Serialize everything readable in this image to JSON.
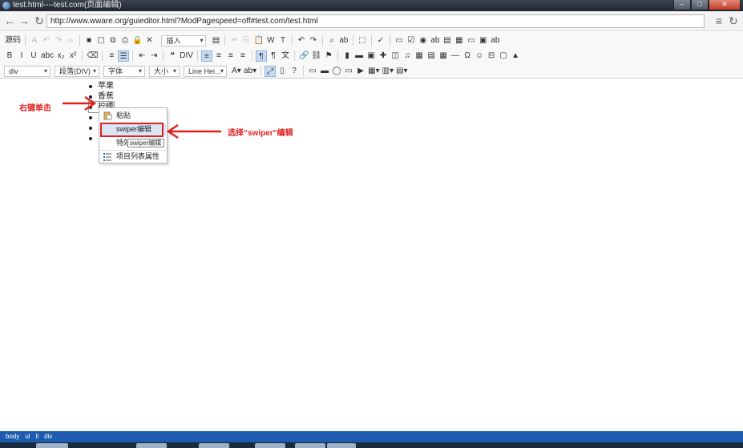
{
  "window": {
    "title": "test.html----test.com(页面编辑)"
  },
  "address_bar": {
    "url": "http://www.wware.org/guieditor.html?ModPagespeed=off#test.com/test.html"
  },
  "toolbar": {
    "row1": [
      {
        "name": "source-button",
        "label": "源码",
        "interactable": true
      },
      {
        "name": "sep",
        "sep": true
      },
      {
        "name": "paste-text-icon",
        "label": "A",
        "interactable": true,
        "dim": true
      },
      {
        "name": "undo-icon",
        "label": "↶",
        "interactable": true,
        "dim": true
      },
      {
        "name": "redo-icon",
        "label": "↷",
        "interactable": true,
        "dim": true
      },
      {
        "name": "code-icon",
        "label": "‹›",
        "interactable": true,
        "dim": true
      },
      {
        "name": "sep",
        "sep": true
      },
      {
        "name": "save-icon",
        "label": "■",
        "interactable": true
      },
      {
        "name": "new-page-icon",
        "label": "▢",
        "interactable": true
      },
      {
        "name": "preview-icon",
        "label": "⧉",
        "interactable": true
      },
      {
        "name": "print-icon",
        "label": "⎙",
        "interactable": true
      },
      {
        "name": "lock-icon",
        "label": "🔒",
        "interactable": true
      },
      {
        "name": "remove-icon",
        "label": "✕",
        "interactable": true
      }
    ],
    "insert_combo": "插入",
    "row1b": [
      {
        "name": "template-icon",
        "label": "▤"
      },
      {
        "name": "sep",
        "sep": true
      },
      {
        "name": "cut-icon",
        "label": "✂",
        "dim": true
      },
      {
        "name": "copy-icon",
        "label": "⎘",
        "dim": true
      },
      {
        "name": "paste-icon",
        "label": "📋"
      },
      {
        "name": "paste-word-icon",
        "label": "W"
      },
      {
        "name": "paste-plain-icon",
        "label": "T"
      },
      {
        "name": "sep",
        "sep": true
      },
      {
        "name": "undo-button-icon",
        "label": "↶"
      },
      {
        "name": "redo-button-icon",
        "label": "↷"
      },
      {
        "name": "sep",
        "sep": true
      },
      {
        "name": "find-icon",
        "label": "⌕"
      },
      {
        "name": "replace-icon",
        "label": "ab"
      },
      {
        "name": "sep",
        "sep": true
      },
      {
        "name": "select-all-icon",
        "label": "⬚"
      },
      {
        "name": "sep",
        "sep": true
      },
      {
        "name": "spellcheck-icon",
        "label": "✓"
      },
      {
        "name": "sep",
        "sep": true
      },
      {
        "name": "form-icon",
        "label": "▭"
      },
      {
        "name": "checkbox-icon",
        "label": "☑"
      },
      {
        "name": "radio-icon",
        "label": "◉"
      },
      {
        "name": "textfield-icon",
        "label": "ab"
      },
      {
        "name": "textarea-icon",
        "label": "▤"
      },
      {
        "name": "select-icon",
        "label": "▦"
      },
      {
        "name": "button-icon",
        "label": "▭"
      },
      {
        "name": "image-button-icon",
        "label": "▣"
      },
      {
        "name": "hidden-field-icon",
        "label": "ab"
      }
    ],
    "row2": [
      {
        "name": "bold-icon",
        "label": "B"
      },
      {
        "name": "italic-icon",
        "label": "I"
      },
      {
        "name": "underline-icon",
        "label": "U"
      },
      {
        "name": "strike-icon",
        "label": "abc"
      },
      {
        "name": "subscript-icon",
        "label": "x₂"
      },
      {
        "name": "superscript-icon",
        "label": "x²"
      },
      {
        "name": "sep",
        "sep": true
      },
      {
        "name": "remove-format-icon",
        "label": "⌫"
      },
      {
        "name": "sep",
        "sep": true
      },
      {
        "name": "numbered-list-icon",
        "label": "≡"
      },
      {
        "name": "bulleted-list-icon",
        "label": "☰",
        "on": true
      },
      {
        "name": "sep",
        "sep": true
      },
      {
        "name": "outdent-icon",
        "label": "⇤"
      },
      {
        "name": "indent-icon",
        "label": "⇥"
      },
      {
        "name": "sep",
        "sep": true
      },
      {
        "name": "blockquote-icon",
        "label": "❝"
      },
      {
        "name": "div-icon",
        "label": "DIV"
      },
      {
        "name": "sep",
        "sep": true
      },
      {
        "name": "align-left-icon",
        "label": "≡",
        "on": true
      },
      {
        "name": "align-center-icon",
        "label": "≡"
      },
      {
        "name": "align-right-icon",
        "label": "≡"
      },
      {
        "name": "justify-icon",
        "label": "≡"
      },
      {
        "name": "sep",
        "sep": true
      },
      {
        "name": "ltr-icon",
        "label": "¶",
        "on": true
      },
      {
        "name": "rtl-icon",
        "label": "¶"
      },
      {
        "name": "language-icon",
        "label": "文"
      },
      {
        "name": "sep",
        "sep": true
      },
      {
        "name": "link-icon",
        "label": "🔗"
      },
      {
        "name": "unlink-icon",
        "label": "⛓"
      },
      {
        "name": "anchor-icon",
        "label": "⚑"
      },
      {
        "name": "sep",
        "sep": true
      },
      {
        "name": "chart-icon",
        "label": "▮"
      },
      {
        "name": "video-icon",
        "label": "▬"
      },
      {
        "name": "image-icon",
        "label": "▣"
      },
      {
        "name": "flash-icon",
        "label": "✚"
      },
      {
        "name": "media-icon",
        "label": "◫"
      },
      {
        "name": "music-icon",
        "label": "♫"
      },
      {
        "name": "map-icon",
        "label": "▦"
      },
      {
        "name": "doc-icon",
        "label": "▤"
      },
      {
        "name": "table-icon",
        "label": "▦"
      },
      {
        "name": "hr-icon",
        "label": "―"
      },
      {
        "name": "special-char-icon",
        "label": "Ω"
      },
      {
        "name": "smiley-icon",
        "label": "☺"
      },
      {
        "name": "page-break-icon",
        "label": "⊟"
      },
      {
        "name": "iframe-icon",
        "label": "▢"
      },
      {
        "name": "nav-icon",
        "label": "▲"
      }
    ],
    "combos": [
      "div",
      "段落(DIV)",
      "字体",
      "大小",
      "Line Hei…"
    ],
    "row3": [
      {
        "name": "text-color-icon",
        "label": "A▾"
      },
      {
        "name": "bg-color-icon",
        "label": "ab▾"
      },
      {
        "name": "sep",
        "sep": true
      },
      {
        "name": "maximize-icon",
        "label": "⤢",
        "on": true
      },
      {
        "name": "show-blocks-icon",
        "label": "▯"
      },
      {
        "name": "about-icon",
        "label": "?"
      },
      {
        "name": "sep",
        "sep": true
      },
      {
        "name": "widget-1-icon",
        "label": "▭"
      },
      {
        "name": "widget-2-icon",
        "label": "▬"
      },
      {
        "name": "widget-3-icon",
        "label": "◯"
      },
      {
        "name": "widget-4-icon",
        "label": "▭"
      },
      {
        "name": "widget-5-icon",
        "label": "▶"
      },
      {
        "name": "widget-6-icon",
        "label": "▦▾"
      },
      {
        "name": "widget-7-icon",
        "label": "▥▾"
      },
      {
        "name": "widget-8-icon",
        "label": "▤▾"
      }
    ]
  },
  "content": {
    "list_items": [
      "苹果",
      "香蕉",
      "柠檬",
      "",
      "",
      ""
    ]
  },
  "annotations": {
    "left": "右键单击",
    "right": "选择“swiper”编辑"
  },
  "context_menu": {
    "items": [
      {
        "label": "粘贴",
        "icon": "paste-icon"
      },
      {
        "label": "swiper编辑",
        "selected": true
      },
      {
        "label": "特效"
      },
      {
        "label": "项目列表属性",
        "icon": "list-props-icon"
      }
    ],
    "tooltip": "swiper编辑"
  },
  "status_bar": {
    "path": [
      "body",
      "ul",
      "li",
      "div"
    ]
  },
  "colors": {
    "annotation": "#e0201f",
    "status": "#1c5bb0",
    "highlight": "#d9e4f5"
  }
}
